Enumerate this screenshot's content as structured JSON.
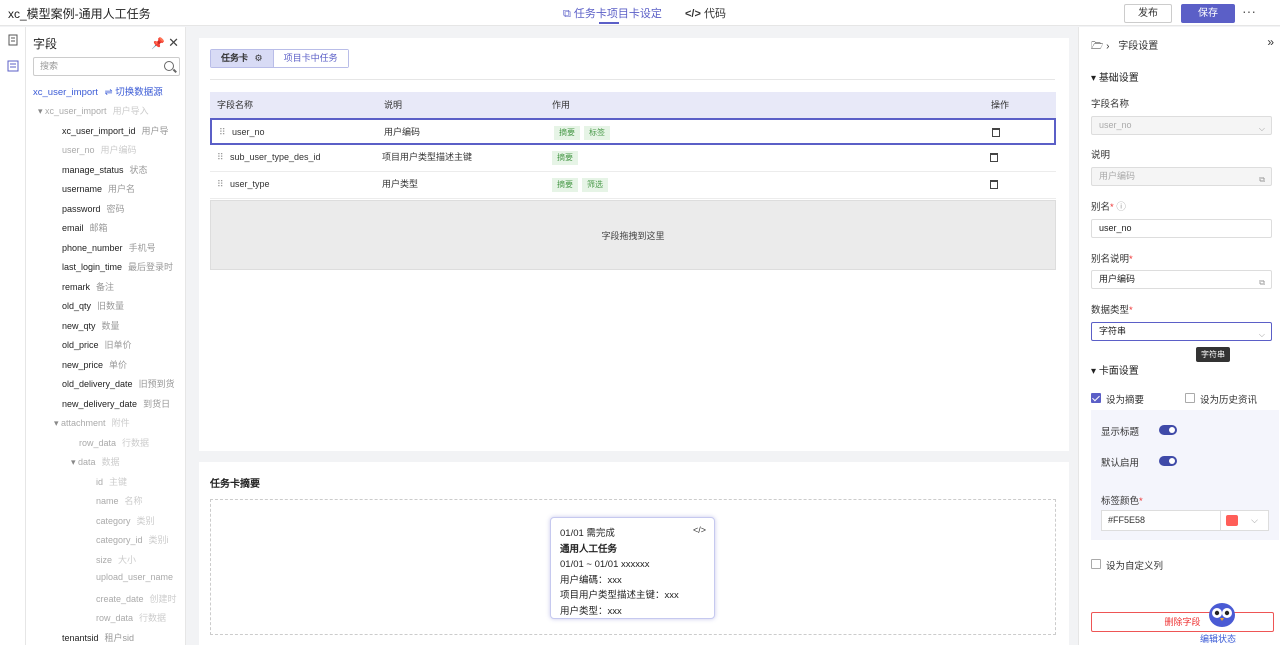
{
  "topbar": {
    "app_title": "xc_模型案例-通用人工任务",
    "tab_task_card": "任务卡项目卡设定",
    "tab_code": "代码",
    "publish_label": "发布",
    "save_label": "保存",
    "more": "···"
  },
  "field_panel": {
    "title": "字段",
    "search_placeholder": "搜索",
    "datasource": "xc_user_import",
    "switch_label": "⇌ 切换数据源",
    "items": [
      {
        "name": "xc_user_import",
        "desc": "用户导入"
      },
      {
        "name": "xc_user_import_id",
        "desc": "用户导"
      },
      {
        "name": "user_no",
        "desc": "用户编码"
      },
      {
        "name": "manage_status",
        "desc": "状态"
      },
      {
        "name": "username",
        "desc": "用户名"
      },
      {
        "name": "password",
        "desc": "密码"
      },
      {
        "name": "email",
        "desc": "邮箱"
      },
      {
        "name": "phone_number",
        "desc": "手机号"
      },
      {
        "name": "last_login_time",
        "desc": "最后登录时"
      },
      {
        "name": "remark",
        "desc": "备注"
      },
      {
        "name": "old_qty",
        "desc": "旧数量"
      },
      {
        "name": "new_qty",
        "desc": "数量"
      },
      {
        "name": "old_price",
        "desc": "旧单价"
      },
      {
        "name": "new_price",
        "desc": "单价"
      },
      {
        "name": "old_delivery_date",
        "desc": "旧预到货"
      },
      {
        "name": "new_delivery_date",
        "desc": "到货日"
      },
      {
        "name": "attachment",
        "desc": "附件"
      },
      {
        "name": "row_data",
        "desc": "行数据"
      },
      {
        "name": "data",
        "desc": "数据"
      },
      {
        "name": "id",
        "desc": "主键"
      },
      {
        "name": "name",
        "desc": "名称"
      },
      {
        "name": "category",
        "desc": "类别"
      },
      {
        "name": "category_id",
        "desc": "类别i"
      },
      {
        "name": "size",
        "desc": "大小"
      },
      {
        "name": "upload_user_name",
        "desc": ""
      },
      {
        "name": "create_date",
        "desc": "创建时"
      },
      {
        "name": "row_data",
        "desc": "行数据"
      },
      {
        "name": "tenantsid",
        "desc": "租户sid"
      }
    ]
  },
  "main": {
    "seg_task_card": "任务卡",
    "seg_project_task": "项目卡中任务",
    "headers": {
      "field_name": "字段名称",
      "desc": "说明",
      "role": "作用",
      "op": "操作"
    },
    "rows": [
      {
        "field": "user_no",
        "desc": "用户编码",
        "tags": [
          "摘要",
          "标签"
        ]
      },
      {
        "field": "sub_user_type_des_id",
        "desc": "项目用户类型描述主键",
        "tags": [
          "摘要"
        ]
      },
      {
        "field": "user_type",
        "desc": "用户类型",
        "tags": [
          "摘要",
          "筛选"
        ]
      }
    ],
    "drop_hint": "字段拖拽到这里"
  },
  "summary": {
    "title": "任务卡摘要",
    "card": {
      "line1": "01/01 需完成",
      "line2": "通用人工任务",
      "line3": "01/01 ~ 01/01 xxxxxx",
      "line4": "用户编碼：xxx",
      "line5": "项目用户类型描述主键：xxx",
      "line6": "用户类型：xxx"
    }
  },
  "right_panel": {
    "head": "字段设置",
    "basic_section": "基础设置",
    "field_name_label": "字段名称",
    "field_name_value": "user_no",
    "desc_label": "说明",
    "desc_value": "用户编码",
    "alias_label": "别名",
    "alias_value": "user_no",
    "alias_desc_label": "别名说明",
    "alias_desc_value": "用户编码",
    "data_type_label": "数据类型",
    "data_type_value": "字符串",
    "tooltip": "字符串",
    "card_section": "卡面设置",
    "set_summary": "设为摘要",
    "set_history": "设为历史资讯",
    "show_title": "显示标题",
    "default_enable": "默认启用",
    "tag_color_label": "标签颜色",
    "tag_color_value": "#FF5E58",
    "set_custom": "设为自定义列",
    "delete_field": "删除字段",
    "edit_state": "编辑状态"
  },
  "colors": {
    "accent": "#5b5fc7",
    "tag_color": "#FF5E58"
  }
}
